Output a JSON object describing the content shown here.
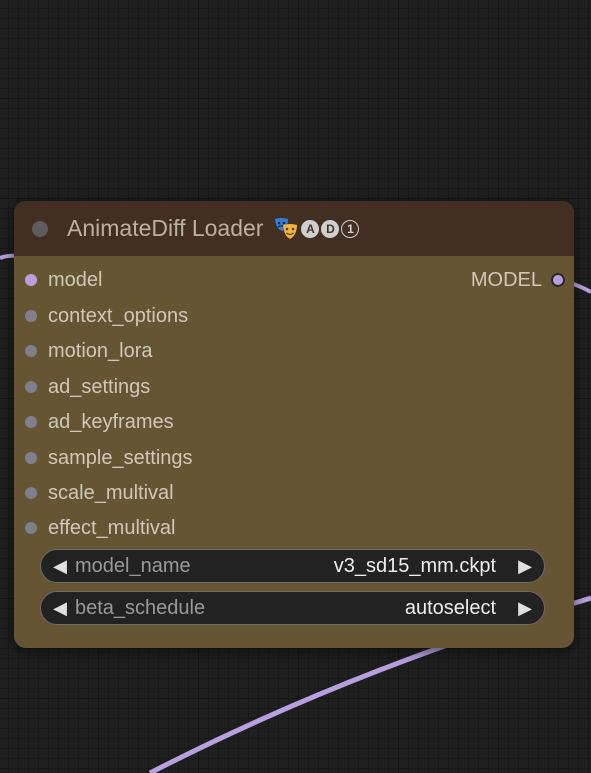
{
  "node": {
    "title": "AnimateDiff Loader",
    "title_icon": "theater-masks-icon",
    "badges": [
      "A",
      "D",
      "1"
    ],
    "colors": {
      "body": "#665533",
      "header": "#432f21",
      "link": "#b8a0e0"
    },
    "inputs": [
      {
        "label": "model",
        "connected": true
      },
      {
        "label": "context_options",
        "connected": false
      },
      {
        "label": "motion_lora",
        "connected": false
      },
      {
        "label": "ad_settings",
        "connected": false
      },
      {
        "label": "ad_keyframes",
        "connected": false
      },
      {
        "label": "sample_settings",
        "connected": false
      },
      {
        "label": "scale_multival",
        "connected": false
      },
      {
        "label": "effect_multival",
        "connected": false
      }
    ],
    "output": {
      "label": "MODEL",
      "connected": true
    },
    "widgets": [
      {
        "label": "model_name",
        "value": "v3_sd15_mm.ckpt"
      },
      {
        "label": "beta_schedule",
        "value": "autoselect"
      }
    ]
  }
}
